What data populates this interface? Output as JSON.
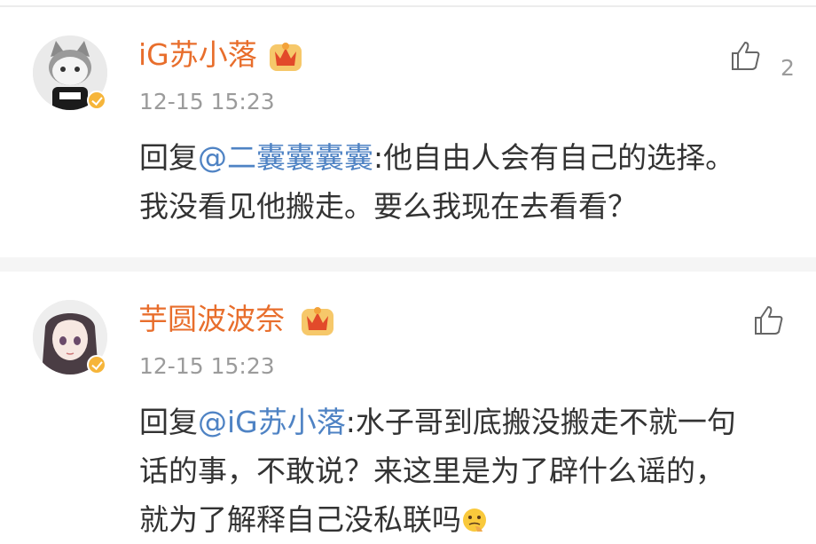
{
  "comments": [
    {
      "username": "iG苏小落",
      "timestamp": "12-15 15:23",
      "reply_prefix": "回复",
      "mention": "@二囊囊囊囊",
      "text_after_mention": ":他自由人会有自己的选择。我没看见他搬走。要么我现在去看看？",
      "like_count": "2",
      "avatar": "cartoon-cat-avatar",
      "badge": "vip-crown-badge"
    },
    {
      "username": "芋圆波波奈",
      "timestamp": "12-15 15:23",
      "reply_prefix": "回复",
      "mention": "@iG苏小落",
      "text_after_mention": ":水子哥到底搬没搬走不就一句话的事，不敢说？来这里是为了辟什么谣的，就为了解释自己没私联吗",
      "like_count": "",
      "avatar": "anime-girl-avatar",
      "badge": "vip-crown-badge",
      "trailing_emoji": "thinking-face-emoji"
    }
  ],
  "colors": {
    "username": "#e86e2c",
    "mention": "#4f83c4",
    "text": "#333333",
    "meta": "#9b9b9b",
    "verified": "#f6b53a"
  }
}
